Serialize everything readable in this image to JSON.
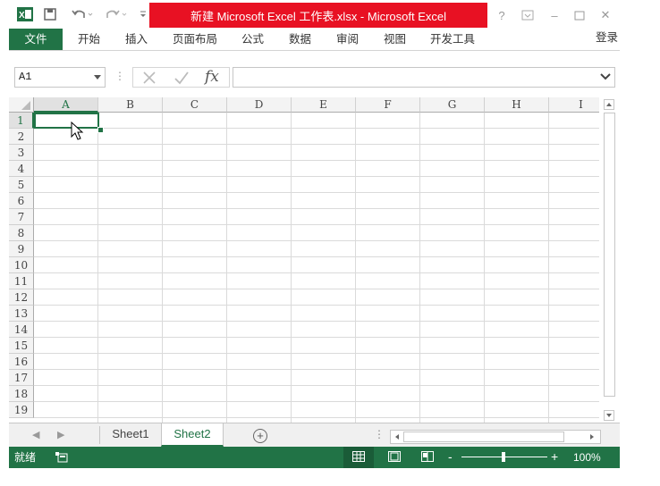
{
  "window": {
    "title": "新建 Microsoft Excel 工作表.xlsx -  Microsoft Excel",
    "help": "?",
    "minimize": "–",
    "close": "✕"
  },
  "qat": {
    "undo_icon": "undo-icon",
    "redo_icon": "redo-icon",
    "save_icon": "save-icon"
  },
  "ribbon": {
    "tabs": [
      {
        "label": "文件"
      },
      {
        "label": "开始"
      },
      {
        "label": "插入"
      },
      {
        "label": "页面布局"
      },
      {
        "label": "公式"
      },
      {
        "label": "数据"
      },
      {
        "label": "审阅"
      },
      {
        "label": "视图"
      },
      {
        "label": "开发工具"
      }
    ],
    "signin": "登录"
  },
  "formula_bar": {
    "name_box": "A1",
    "formula": "",
    "fx": "fx"
  },
  "grid": {
    "columns": [
      "A",
      "B",
      "C",
      "D",
      "E",
      "F",
      "G",
      "H",
      "I"
    ],
    "rows": [
      "1",
      "2",
      "3",
      "4",
      "5",
      "6",
      "7",
      "8",
      "9",
      "10",
      "11",
      "12",
      "13",
      "14",
      "15",
      "16",
      "17",
      "18",
      "19"
    ],
    "selected_cell": "A1"
  },
  "sheets": {
    "tabs": [
      "Sheet1",
      "Sheet2"
    ],
    "active": "Sheet2",
    "add": "+"
  },
  "status": {
    "ready": "就绪",
    "zoom": "100%",
    "zoom_minus": "-",
    "zoom_plus": "+"
  },
  "colors": {
    "accent": "#217346",
    "title_bar": "#e81123"
  }
}
